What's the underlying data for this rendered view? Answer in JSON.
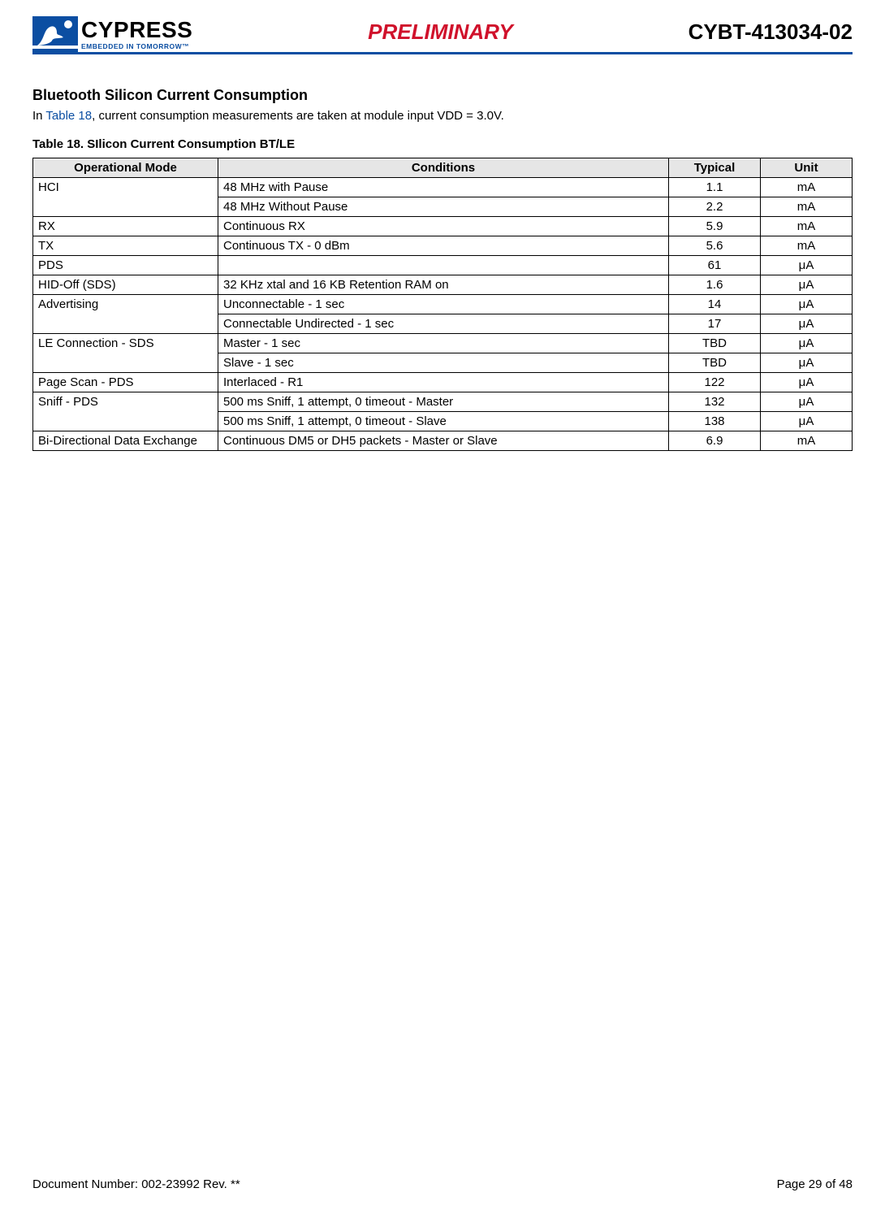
{
  "header": {
    "logo_main": "CYPRESS",
    "logo_sub": "EMBEDDED IN TOMORROW™",
    "watermark": "PRELIMINARY",
    "doc_code": "CYBT-413034-02"
  },
  "section": {
    "title": "Bluetooth Silicon Current Consumption",
    "intro_prefix": "In ",
    "intro_link": "Table 18",
    "intro_suffix": ", current consumption measurements are taken at module input VDD = 3.0V.",
    "table_caption": "Table 18.  SIlicon Current Consumption BT/LE"
  },
  "table": {
    "headers": {
      "mode": "Operational Mode",
      "conditions": "Conditions",
      "typical": "Typical",
      "unit": "Unit"
    },
    "rows": [
      {
        "mode": "HCI",
        "rowspan": 2,
        "conditions": "48 MHz with Pause",
        "typical": "1.1",
        "unit": "mA"
      },
      {
        "mode": null,
        "conditions": "48 MHz Without Pause",
        "typical": "2.2",
        "unit": "mA"
      },
      {
        "mode": "RX",
        "rowspan": 1,
        "conditions": "Continuous RX",
        "typical": "5.9",
        "unit": "mA"
      },
      {
        "mode": "TX",
        "rowspan": 1,
        "conditions": "Continuous TX - 0 dBm",
        "typical": "5.6",
        "unit": "mA"
      },
      {
        "mode": "PDS",
        "rowspan": 1,
        "conditions": "",
        "typical": "61",
        "unit": "μA"
      },
      {
        "mode": "HID-Off (SDS)",
        "rowspan": 1,
        "conditions": "32 KHz xtal and 16 KB Retention RAM on",
        "typical": "1.6",
        "unit": "μA"
      },
      {
        "mode": "Advertising",
        "rowspan": 2,
        "conditions": "Unconnectable - 1 sec",
        "typical": "14",
        "unit": "μA"
      },
      {
        "mode": null,
        "conditions": "Connectable Undirected - 1 sec",
        "typical": "17",
        "unit": "μA"
      },
      {
        "mode": "LE Connection - SDS",
        "rowspan": 2,
        "conditions": "Master - 1 sec",
        "typical": "TBD",
        "unit": "μA"
      },
      {
        "mode": null,
        "conditions": "Slave - 1 sec",
        "typical": "TBD",
        "unit": "μA"
      },
      {
        "mode": "Page Scan - PDS",
        "rowspan": 1,
        "conditions": "Interlaced - R1",
        "typical": "122",
        "unit": "μA"
      },
      {
        "mode": "Sniff - PDS",
        "rowspan": 2,
        "conditions": "500 ms Sniff, 1 attempt, 0 timeout - Master",
        "typical": "132",
        "unit": "μA"
      },
      {
        "mode": null,
        "conditions": "500 ms Sniff, 1 attempt, 0 timeout - Slave",
        "typical": "138",
        "unit": "μA"
      },
      {
        "mode": "Bi-Directional Data Exchange",
        "rowspan": 1,
        "conditions": "Continuous DM5 or DH5 packets - Master or Slave",
        "typical": "6.9",
        "unit": "mA"
      }
    ]
  },
  "footer": {
    "doc_number": "Document Number: 002-23992 Rev. **",
    "page": "Page 29 of 48"
  }
}
